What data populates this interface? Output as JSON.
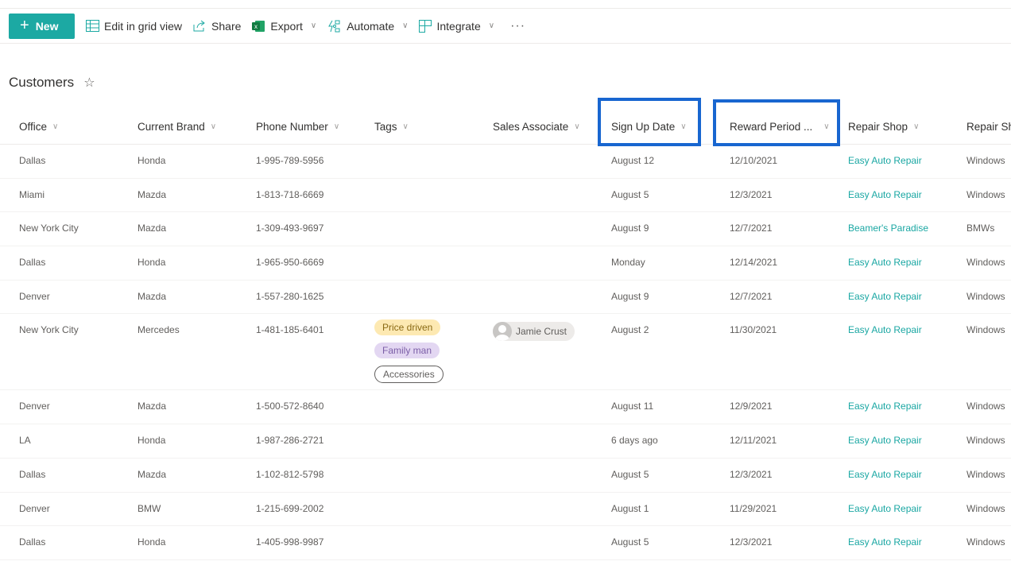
{
  "toolbar": {
    "new_label": "New",
    "edit_grid_label": "Edit in grid view",
    "share_label": "Share",
    "export_label": "Export",
    "automate_label": "Automate",
    "integrate_label": "Integrate",
    "more_label": "···",
    "accent_color": "#1ca9a3"
  },
  "list": {
    "title": "Customers",
    "favorite_icon": "☆"
  },
  "columns": [
    {
      "label": "Office"
    },
    {
      "label": "Current Brand"
    },
    {
      "label": "Phone Number"
    },
    {
      "label": "Tags"
    },
    {
      "label": "Sales Associate"
    },
    {
      "label": "Sign Up Date",
      "highlighted": true
    },
    {
      "label": "Reward Period ...",
      "highlighted": true
    },
    {
      "label": "Repair Shop"
    },
    {
      "label": "Repair Sh"
    }
  ],
  "highlight_color": "#1866d0",
  "rows": [
    {
      "office": "Dallas",
      "brand": "Honda",
      "phone": "1-995-789-5956",
      "signup": "August 12",
      "reward": "12/10/2021",
      "shop": "Easy Auto Repair",
      "shop2": "Windows"
    },
    {
      "office": "Miami",
      "brand": "Mazda",
      "phone": "1-813-718-6669",
      "signup": "August 5",
      "reward": "12/3/2021",
      "shop": "Easy Auto Repair",
      "shop2": "Windows"
    },
    {
      "office": "New York City",
      "brand": "Mazda",
      "phone": "1-309-493-9697",
      "signup": "August 9",
      "reward": "12/7/2021",
      "shop": "Beamer's Paradise",
      "shop2": "BMWs"
    },
    {
      "office": "Dallas",
      "brand": "Honda",
      "phone": "1-965-950-6669",
      "signup": "Monday",
      "reward": "12/14/2021",
      "shop": "Easy Auto Repair",
      "shop2": "Windows"
    },
    {
      "office": "Denver",
      "brand": "Mazda",
      "phone": "1-557-280-1625",
      "signup": "August 9",
      "reward": "12/7/2021",
      "shop": "Easy Auto Repair",
      "shop2": "Windows"
    },
    {
      "office": "New York City",
      "brand": "Mercedes",
      "phone": "1-481-185-6401",
      "tags": [
        "Price driven",
        "Family man",
        "Accessories"
      ],
      "associate": "Jamie Crust",
      "signup": "August 2",
      "reward": "11/30/2021",
      "shop": "Easy Auto Repair",
      "shop2": "Windows"
    },
    {
      "office": "Denver",
      "brand": "Mazda",
      "phone": "1-500-572-8640",
      "signup": "August 11",
      "reward": "12/9/2021",
      "shop": "Easy Auto Repair",
      "shop2": "Windows"
    },
    {
      "office": "LA",
      "brand": "Honda",
      "phone": "1-987-286-2721",
      "signup": "6 days ago",
      "reward": "12/11/2021",
      "shop": "Easy Auto Repair",
      "shop2": "Windows"
    },
    {
      "office": "Dallas",
      "brand": "Mazda",
      "phone": "1-102-812-5798",
      "signup": "August 5",
      "reward": "12/3/2021",
      "shop": "Easy Auto Repair",
      "shop2": "Windows"
    },
    {
      "office": "Denver",
      "brand": "BMW",
      "phone": "1-215-699-2002",
      "signup": "August 1",
      "reward": "11/29/2021",
      "shop": "Easy Auto Repair",
      "shop2": "Windows"
    },
    {
      "office": "Dallas",
      "brand": "Honda",
      "phone": "1-405-998-9987",
      "signup": "August 5",
      "reward": "12/3/2021",
      "shop": "Easy Auto Repair",
      "shop2": "Windows"
    }
  ]
}
